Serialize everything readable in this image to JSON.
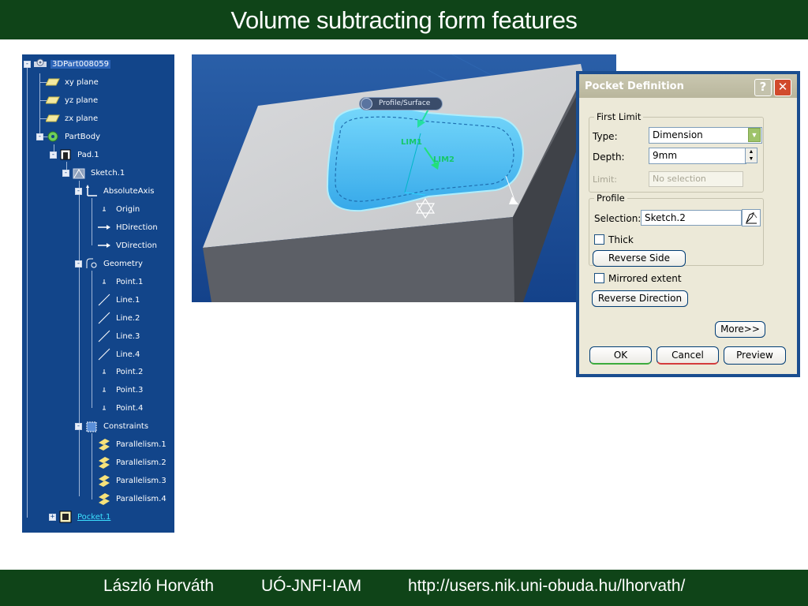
{
  "slide": {
    "title": "Volume subtracting form features",
    "footer": {
      "author": "László Horváth",
      "org": "UÓ-JNFI-IAM",
      "url": "http://users.nik.uni-obuda.hu/lhorvath/"
    }
  },
  "tree": {
    "root": "3DPart008059",
    "planes": [
      "xy plane",
      "yz plane",
      "zx plane"
    ],
    "part_body": "PartBody",
    "pad": "Pad.1",
    "sketch": "Sketch.1",
    "absolute_axis": "AbsoluteAxis",
    "axis_items": [
      "Origin",
      "HDirection",
      "VDirection"
    ],
    "geometry": "Geometry",
    "geometry_items": [
      "Point.1",
      "Line.1",
      "Line.2",
      "Line.3",
      "Line.4",
      "Point.2",
      "Point.3",
      "Point.4"
    ],
    "constraints": "Constraints",
    "constraint_items": [
      "Parallelism.1",
      "Parallelism.2",
      "Parallelism.3",
      "Parallelism.4"
    ],
    "pocket": "Pocket.1"
  },
  "viewport": {
    "profile_tag": "Profile/Surface",
    "lim1": "LIM1",
    "lim2": "LIM2"
  },
  "dialog": {
    "title": "Pocket Definition",
    "help_label": "?",
    "close_label": "✕",
    "first_limit": {
      "group_label": "First Limit",
      "type_label": "Type:",
      "type_value": "Dimension",
      "depth_label": "Depth:",
      "depth_value": "9mm",
      "limit_label": "Limit:",
      "limit_value": "No selection"
    },
    "profile": {
      "group_label": "Profile",
      "selection_label": "Selection:",
      "selection_value": "Sketch.2",
      "thick_label": "Thick",
      "thick_checked": false,
      "reverse_side_label": "Reverse Side"
    },
    "mirrored_label": "Mirrored extent",
    "mirrored_checked": false,
    "reverse_direction_label": "Reverse Direction",
    "more_label": "More>>",
    "ok_label": "OK",
    "cancel_label": "Cancel",
    "preview_label": "Preview"
  }
}
